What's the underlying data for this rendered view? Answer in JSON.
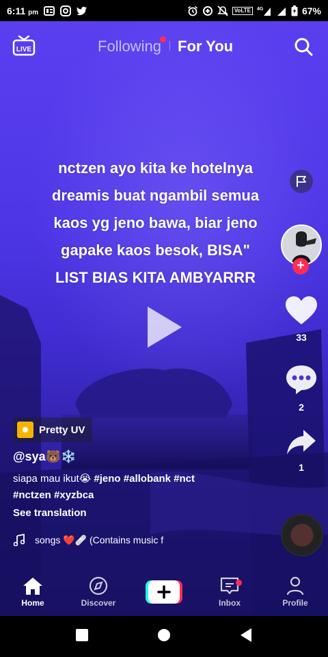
{
  "status_bar": {
    "time": "6:11",
    "ampm": "pm",
    "network": "VoLTE",
    "signal": "4G",
    "battery": "67%"
  },
  "top_nav": {
    "live_label": "LIVE",
    "tab_following": "Following",
    "tab_for_you": "For You"
  },
  "video": {
    "overlay_lines": [
      "nctzen ayo kita ke hotelnya",
      "dreamis buat ngambil semua",
      "kaos yg jeno bawa, biar jeno",
      "gapake kaos besok, BISA\"",
      "LIST BIAS KITA AMBYARRR"
    ]
  },
  "actions": {
    "likes": "33",
    "comments": "2",
    "shares": "1"
  },
  "post": {
    "effect": "Pretty UV",
    "username": "@sya🐻❄️",
    "description_text": "siapa mau ikut😭",
    "hashtags_line1": "#jeno #allobank #nct",
    "hashtags_line2": "#nctzen #xyzbca",
    "see_translation": "See translation",
    "music": "songs ❤️🩹 (Contains music f"
  },
  "tabbar": {
    "home": "Home",
    "discover": "Discover",
    "inbox": "Inbox",
    "profile": "Profile"
  },
  "colors": {
    "accent_red": "#fe2c55",
    "create_cyan": "#25f4ee",
    "video_purple": "#4d35e6"
  }
}
